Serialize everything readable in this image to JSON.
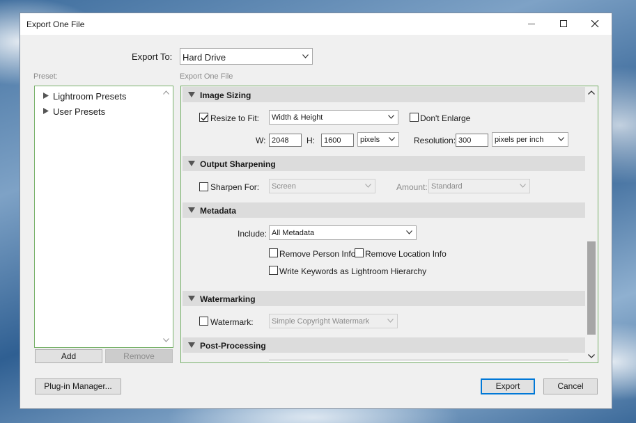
{
  "window": {
    "title": "Export One File"
  },
  "export_to": {
    "label": "Export To:",
    "value": "Hard Drive"
  },
  "preset": {
    "label": "Preset:",
    "items": [
      {
        "label": "Lightroom Presets"
      },
      {
        "label": "User Presets"
      }
    ],
    "add_label": "Add",
    "remove_label": "Remove"
  },
  "panel_label": "Export One File",
  "image_sizing": {
    "title": "Image Sizing",
    "resize_label": "Resize to Fit:",
    "resize_checked": true,
    "resize_mode": "Width & Height",
    "dont_enlarge_label": "Don't Enlarge",
    "dont_enlarge_checked": false,
    "w_label": "W:",
    "w_value": "2048",
    "h_label": "H:",
    "h_value": "1600",
    "unit": "pixels",
    "resolution_label": "Resolution:",
    "resolution_value": "300",
    "resolution_unit": "pixels per inch"
  },
  "output_sharpening": {
    "title": "Output Sharpening",
    "sharpen_label": "Sharpen For:",
    "sharpen_checked": false,
    "sharpen_value": "Screen",
    "amount_label": "Amount:",
    "amount_value": "Standard"
  },
  "metadata": {
    "title": "Metadata",
    "include_label": "Include:",
    "include_value": "All Metadata",
    "remove_person_label": "Remove Person Info",
    "remove_location_label": "Remove Location Info",
    "write_keywords_label": "Write Keywords as Lightroom Hierarchy"
  },
  "watermarking": {
    "title": "Watermarking",
    "watermark_label": "Watermark:",
    "watermark_checked": false,
    "watermark_value": "Simple Copyright Watermark"
  },
  "post_processing": {
    "title": "Post-Processing"
  },
  "footer": {
    "plugin_label": "Plug-in Manager...",
    "export_label": "Export",
    "cancel_label": "Cancel"
  }
}
